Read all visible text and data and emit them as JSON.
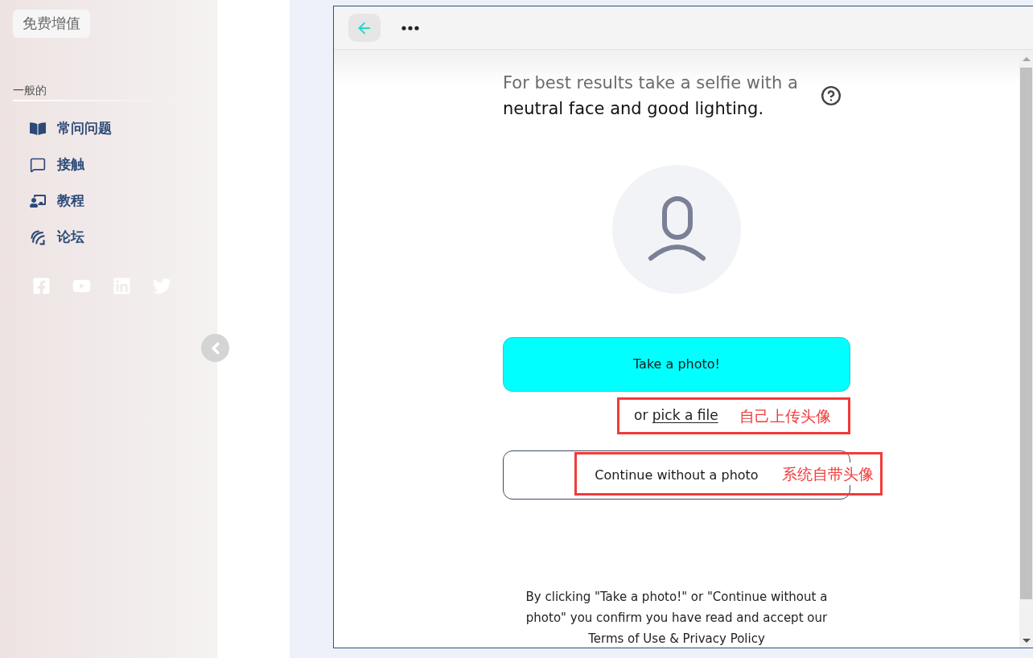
{
  "sidebar": {
    "upgrade_button": "免费增值",
    "section_title": "一般的",
    "items": [
      {
        "label": "常问问题"
      },
      {
        "label": "接触"
      },
      {
        "label": "教程"
      },
      {
        "label": "论坛"
      }
    ],
    "social_links": [
      {
        "kind": "facebook"
      },
      {
        "kind": "youtube"
      },
      {
        "kind": "linkedin"
      },
      {
        "kind": "twitter"
      }
    ]
  },
  "panel": {
    "intro": {
      "hint": "For best results take a selfie with a",
      "emphasis": "neutral face and good lighting."
    },
    "take_photo_button": "Take a photo!",
    "pick_file": {
      "prefix": "or",
      "link": "pick a file"
    },
    "continue_button": "Continue without a photo",
    "consent": {
      "text": "By clicking \"Take a photo!\" or \"Continue without a photo\" you confirm you have read and accept our",
      "link": "Terms of Use & Privacy Policy"
    }
  },
  "annotations": [
    {
      "label": "自己上传头像"
    },
    {
      "label": "系统自带头像"
    }
  ]
}
